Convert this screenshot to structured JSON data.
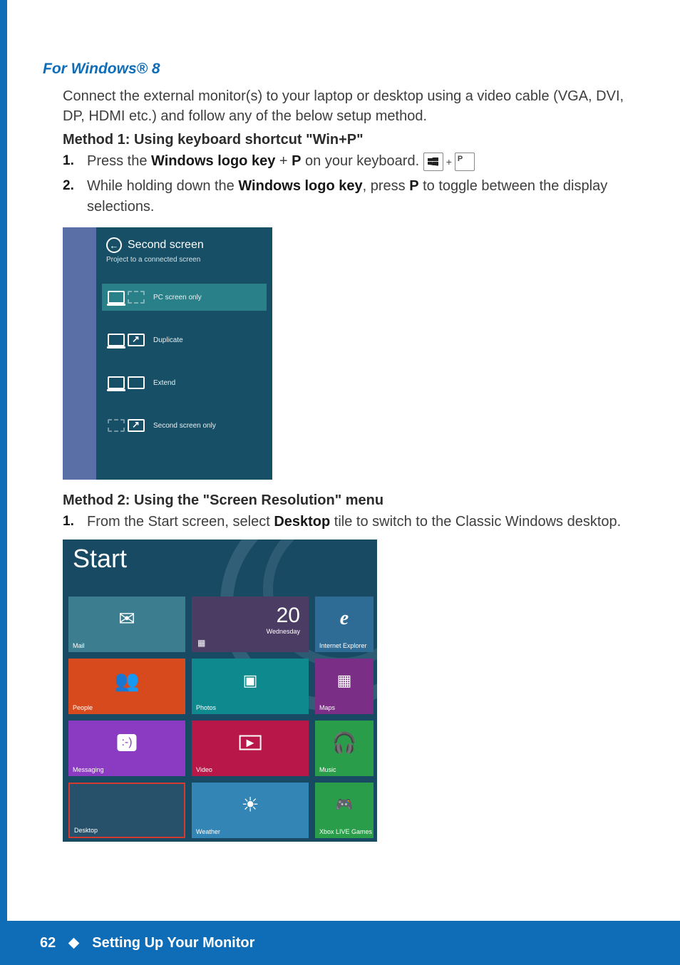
{
  "section_title": "For Windows® 8",
  "intro": "Connect the external monitor(s) to your laptop or desktop using a video cable (VGA, DVI, DP, HDMI etc.) and follow any of the below setup method.",
  "method1": {
    "title": "Method 1: Using keyboard shortcut \"Win+P\"",
    "steps": {
      "s1_num": "1.",
      "s1_a": "Press the ",
      "s1_b": "Windows logo key",
      "s1_c": " + ",
      "s1_d": "P",
      "s1_e": " on your keyboard.  ",
      "s2_num": "2.",
      "s2_a": "While holding down the ",
      "s2_b": "Windows logo key",
      "s2_c": ", press ",
      "s2_d": "P",
      "s2_e": " to toggle between the display selections."
    }
  },
  "panel": {
    "title": "Second screen",
    "subtitle": "Project to a connected screen",
    "opts": [
      "PC screen only",
      "Duplicate",
      "Extend",
      "Second screen only"
    ]
  },
  "method2": {
    "title": "Method 2: Using the \"Screen Resolution\" menu",
    "s1_num": "1.",
    "s1_a": "From the Start screen, select ",
    "s1_b": "Desktop",
    "s1_c": " tile to switch to the Classic Windows desktop."
  },
  "start": {
    "title": "Start",
    "tiles": {
      "mail": "Mail",
      "cal_num": "20",
      "cal_day": "Wednesday",
      "ie": "Internet Explorer",
      "people": "People",
      "photos": "Photos",
      "maps": "Maps",
      "msg": "Messaging",
      "video": "Video",
      "music": "Music",
      "desktop": "Desktop",
      "weather": "Weather",
      "xbox": "Xbox LIVE Games"
    }
  },
  "footer": {
    "page": "62",
    "title": "Setting Up Your Monitor"
  }
}
